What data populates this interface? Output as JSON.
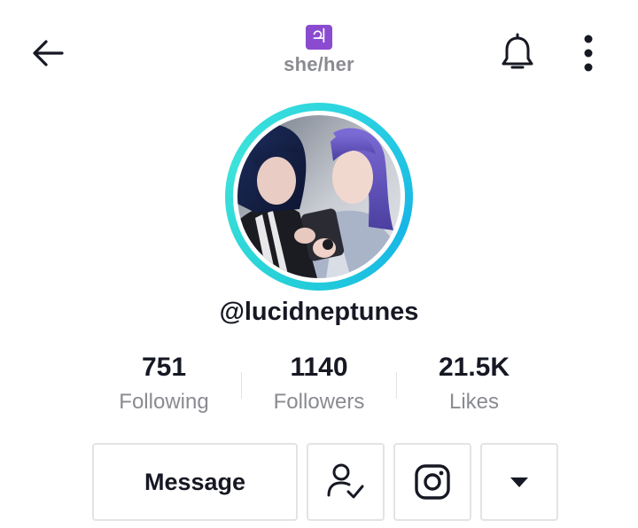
{
  "header": {
    "badge_symbol": "♃",
    "badge_color": "#8a4bd1",
    "pronouns": "she/her",
    "icons": [
      "back-arrow-icon",
      "bell-icon",
      "more-vertical-icon"
    ]
  },
  "profile": {
    "username": "@lucidneptunes",
    "avatar_ring_color": "#2bd4e0"
  },
  "stats": [
    {
      "value": "751",
      "label": "Following"
    },
    {
      "value": "1140",
      "label": "Followers"
    },
    {
      "value": "21.5K",
      "label": "Likes"
    }
  ],
  "actions": {
    "message_label": "Message",
    "icons": [
      "friends-check-icon",
      "instagram-icon",
      "dropdown-caret-icon"
    ]
  },
  "colors": {
    "text_primary": "#161823",
    "text_secondary": "#8a8b91",
    "border": "#e3e3e4"
  }
}
